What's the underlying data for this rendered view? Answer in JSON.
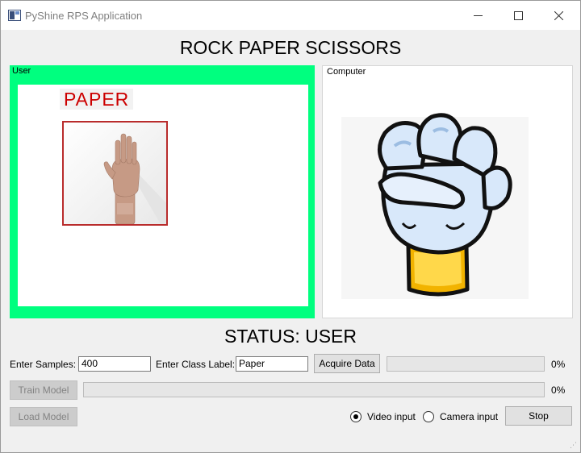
{
  "window": {
    "title": "PyShine RPS Application"
  },
  "heading": "ROCK PAPER SCISSORS",
  "user_panel": {
    "label": "User",
    "prediction": "PAPER",
    "roi_color": "#b92c2c",
    "bg_color": "#00ff7f"
  },
  "computer_panel": {
    "label": "Computer",
    "choice_icon": "rock-fist-icon"
  },
  "status": "STATUS: USER",
  "controls": {
    "samples_label": "Enter Samples:",
    "samples_value": "400",
    "class_label": "Enter Class Label:",
    "class_value": "Paper",
    "acquire_button": "Acquire Data",
    "acquire_progress": "0%",
    "acquire_progress_value": 0,
    "train_button": "Train Model",
    "train_progress": "0%",
    "train_progress_value": 0,
    "load_button": "Load Model",
    "video_input_label": "Video input",
    "camera_input_label": "Camera input",
    "selected_input": "Video input",
    "stop_button": "Stop"
  }
}
